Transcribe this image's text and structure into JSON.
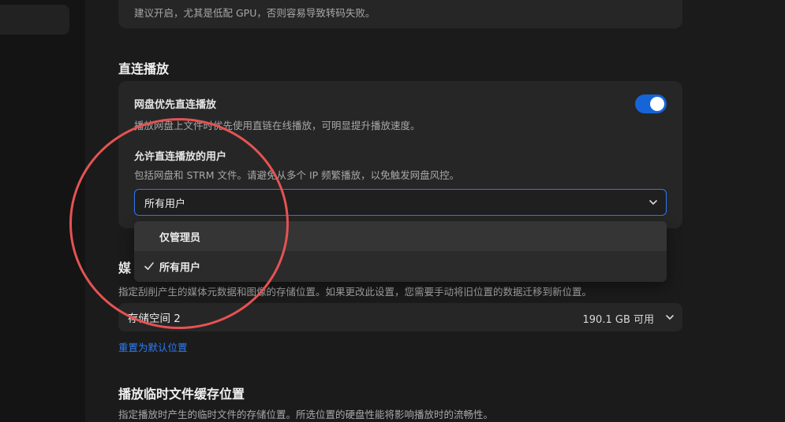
{
  "top_card": {
    "description": "建议开启，尤其是低配 GPU，否则容易导致转码失败。"
  },
  "direct_play": {
    "section_title": "直连播放",
    "priority_title": "网盘优先直连播放",
    "priority_desc": "播放网盘上文件时优先使用直链在线播放，可明显提升播放速度。",
    "priority_enabled": true,
    "users_title": "允许直连播放的用户",
    "users_desc": "包括网盘和 STRM 文件。请避免从多个 IP 频繁播放，以免触发网盘风控。",
    "users_selected": "所有用户",
    "options": [
      "仅管理员",
      "所有用户"
    ]
  },
  "media": {
    "section_title_partial": "媒",
    "description": "指定刮削产生的媒体元数据和图像的存储位置。如果更改此设置，您需要手动将旧位置的数据迁移到新位置。",
    "storage_name": "存储空间 2",
    "storage_free": "190.1 GB 可用",
    "reset_link": "重置为默认位置"
  },
  "cache": {
    "section_title": "播放临时文件缓存位置",
    "description": "指定播放时产生的临时文件的存储位置。所选位置的硬盘性能将影响播放时的流畅性。"
  },
  "colors": {
    "accent": "#1565d8",
    "annotation": "#e55353",
    "link": "#2f7cf6"
  }
}
